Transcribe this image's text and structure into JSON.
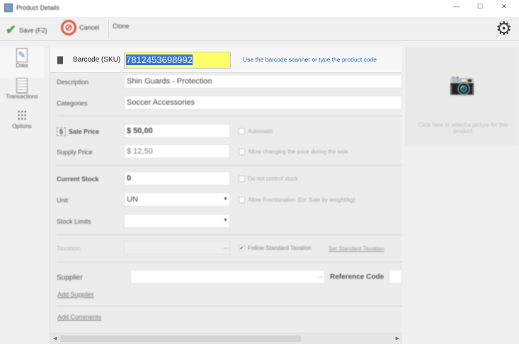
{
  "window": {
    "title": "Product Details",
    "minimize": "—",
    "maximize": "☐",
    "close": "✕"
  },
  "toolbar": {
    "save": "Save (F2)",
    "cancel": "Cancel",
    "clone": "Clone"
  },
  "sidebar": {
    "items": [
      {
        "label": "Data"
      },
      {
        "label": "Transactions"
      },
      {
        "label": "Options"
      }
    ]
  },
  "form": {
    "barcode_label": "Barcode (SKU)",
    "barcode_value": "7812453698992",
    "barcode_hint": "Use the barcode scanner or type the product code",
    "description_label": "Description",
    "description_value": "Shin Guards - Protection",
    "categories_label": "Categories",
    "categories_value": "Soccer Accessories",
    "sale_price_label": "Sale Price",
    "sale_price_value": "$ 50,00",
    "automatic_label": "Automatic",
    "supply_price_label": "Supply Price",
    "supply_price_value": "$ 12,50",
    "allow_change_label": "Allow changing the price during the sale",
    "current_stock_label": "Current Stock",
    "current_stock_value": "0",
    "no_control_label": "Do not control stock",
    "unit_label": "Unit",
    "unit_value": "UN",
    "fraction_label": "Allow Fractionation (Ex: Sale by weight/kg)",
    "stock_limits_label": "Stock Limits",
    "taxation_label": "Taxation",
    "follow_tax_label": "Follow Standard Taxation",
    "set_tax_link": "Set Standard Taxation",
    "supplier_label": "Supplier",
    "reference_label": "Reference Code",
    "add_supplier": "Add Supplier",
    "add_comments": "Add Comments"
  },
  "picture": {
    "hint": "Click here to select a picture for this product"
  }
}
